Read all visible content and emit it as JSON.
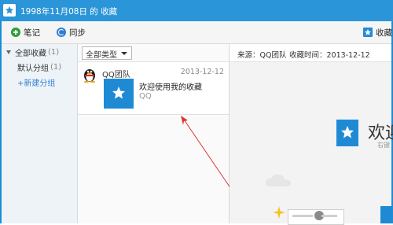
{
  "window": {
    "title": "1998年11月08日 的 收藏"
  },
  "toolbar": {
    "note_label": "笔记",
    "sync_label": "同步",
    "favorites_label": "收藏"
  },
  "sidebar": {
    "all_label": "全部收藏",
    "all_count": "(1)",
    "default_label": "默认分组",
    "default_count": "(1)",
    "new_group_label": "+新建分组"
  },
  "list": {
    "filter_value": "全部类型",
    "items": [
      {
        "source": "QQ团队",
        "date": "2013-12-12",
        "title": "欢迎使用我的收藏",
        "subtitle": "QQ"
      }
    ]
  },
  "detail": {
    "source_text": "来源：QQ团队",
    "time_text": "收藏时间：2013-12-12",
    "welcome_text": "欢迎",
    "hint_text": "右键"
  },
  "colors": {
    "title_bar": "#2a95d8",
    "accent_blue": "#1f8ad4",
    "note_green": "#2e9d3a",
    "annotation_red": "#e0332e"
  },
  "icons": [
    "app-star-icon",
    "plus-circle-icon",
    "sync-icon",
    "favorites-star-icon",
    "expand-triangle-icon",
    "dropdown-arrow-icon",
    "qq-penguin-icon",
    "bookmark-star-icon",
    "cloud-icon",
    "sparkle-icon"
  ]
}
